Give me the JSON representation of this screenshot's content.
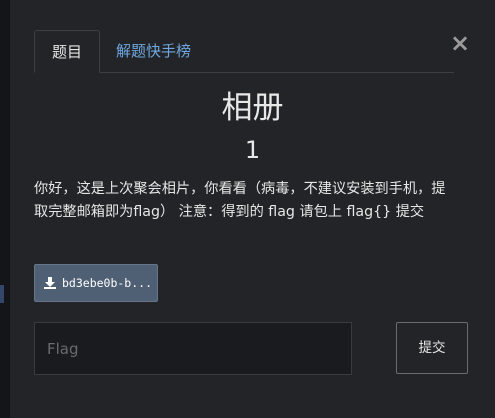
{
  "tabs": [
    {
      "label": "题目",
      "active": true
    },
    {
      "label": "解题快手榜",
      "active": false
    }
  ],
  "close_icon": "close-icon",
  "challenge": {
    "title": "相册",
    "points": "1",
    "description": "你好，这是上次聚会相片，你看看（病毒，不建议安装到手机，提取完整邮箱即为flag） 注意：得到的 flag 请包上 flag{} 提交"
  },
  "attachment": {
    "icon": "download-icon",
    "filename": "bd3ebe0b-b..."
  },
  "flag_form": {
    "placeholder": "Flag",
    "value": "",
    "submit_label": "提交"
  },
  "colors": {
    "background": "#232427",
    "link": "#6ea8e0",
    "download_button": "#4f5f74"
  }
}
